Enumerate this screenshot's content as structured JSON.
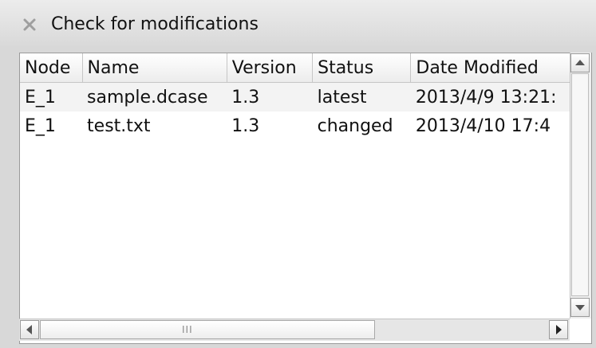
{
  "window": {
    "title": "Check for modifications",
    "close_icon": "close-icon"
  },
  "table": {
    "columns": [
      "Node",
      "Name",
      "Version",
      "Status",
      "Date Modified"
    ],
    "rows": [
      [
        "E_1",
        "sample.dcase",
        "1.3",
        "latest",
        "2013/4/9 13:21:"
      ],
      [
        "E_1",
        "test.txt",
        "1.3",
        "changed",
        "2013/4/10 17:4 "
      ]
    ]
  },
  "scrollbars": {
    "up_icon": "arrow-up-icon",
    "down_icon": "arrow-down-icon",
    "left_icon": "arrow-left-icon",
    "right_icon": "arrow-right-icon",
    "grip_text": "III"
  }
}
